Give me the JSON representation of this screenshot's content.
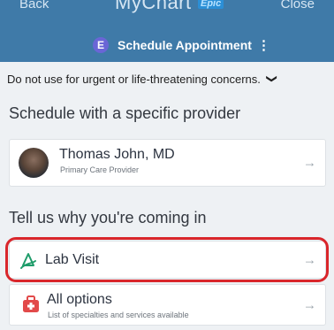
{
  "header": {
    "back_label": "Back",
    "logo_text": "MyChart",
    "logo_badge": "Epic",
    "close_label": "Close",
    "title": "Schedule Appointment",
    "avatar_letter": "E",
    "menu_glyph": "⋮"
  },
  "notice": {
    "text": "Do not use for urgent or life-threatening concerns.",
    "chevron": "❯"
  },
  "provider_section": {
    "title": "Schedule with a specific provider",
    "provider": {
      "name": "Thomas John, MD",
      "role": "Primary Care Provider"
    }
  },
  "reason_section": {
    "title": "Tell us why you're coming in",
    "options": [
      {
        "label": "Lab Visit",
        "subtitle": ""
      },
      {
        "label": "All options",
        "subtitle": "List of specialties and services available"
      }
    ]
  },
  "icons": {
    "arrow": "→",
    "lab": "lab-visit-icon",
    "options": "medical-kit-icon"
  },
  "colors": {
    "header": "#3f7aa8",
    "background": "#eef1f4",
    "highlight": "#d9262b",
    "lab_icon": "#1f9c6a",
    "options_icon": "#e24a4a"
  }
}
